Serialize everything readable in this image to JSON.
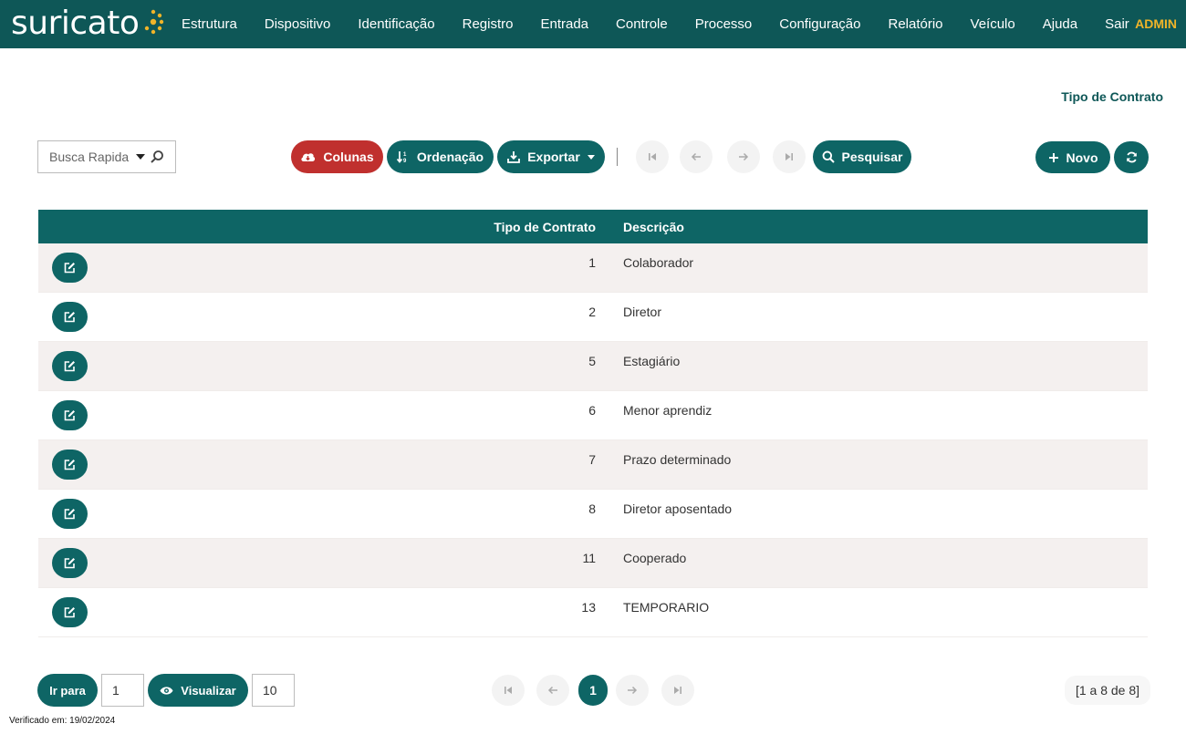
{
  "app": {
    "logo_text": "suricato",
    "brand_color": "#0e5757",
    "accent_color": "#f0b429",
    "user": "ADMIN"
  },
  "nav": {
    "items": [
      {
        "label": "Estrutura"
      },
      {
        "label": "Dispositivo"
      },
      {
        "label": "Identificação"
      },
      {
        "label": "Registro"
      },
      {
        "label": "Entrada"
      },
      {
        "label": "Controle"
      },
      {
        "label": "Processo"
      },
      {
        "label": "Configuração"
      },
      {
        "label": "Relatório"
      },
      {
        "label": "Veículo"
      },
      {
        "label": "Ajuda"
      },
      {
        "label": "Sair"
      }
    ]
  },
  "page": {
    "title": "Tipo de Contrato"
  },
  "toolbar": {
    "search_placeholder": "Busca Rapida",
    "columns_label": "Colunas",
    "sort_label": "Ordenação",
    "export_label": "Exportar",
    "search_label": "Pesquisar",
    "new_label": "Novo",
    "icons": [
      "cloud-download-icon",
      "sort-icon",
      "download-icon",
      "first-page-icon",
      "prev-icon",
      "next-icon",
      "last-page-icon",
      "search-icon",
      "plus-icon",
      "refresh-icon"
    ]
  },
  "table": {
    "headers": {
      "code": "Tipo de Contrato",
      "description": "Descrição"
    },
    "rows": [
      {
        "code": "1",
        "description": "Colaborador"
      },
      {
        "code": "2",
        "description": "Diretor"
      },
      {
        "code": "5",
        "description": "Estagiário"
      },
      {
        "code": "6",
        "description": "Menor aprendiz"
      },
      {
        "code": "7",
        "description": "Prazo determinado"
      },
      {
        "code": "8",
        "description": "Diretor aposentado"
      },
      {
        "code": "11",
        "description": "Cooperado"
      },
      {
        "code": "13",
        "description": "TEMPORARIO"
      }
    ]
  },
  "pager": {
    "goto_label": "Ir para",
    "goto_value": "1",
    "view_label": "Visualizar",
    "page_size": "10",
    "current_page": "1",
    "count_text": "[1 a 8 de 8]"
  },
  "footer": {
    "verified_text": "Verificado em: 19/02/2024"
  }
}
